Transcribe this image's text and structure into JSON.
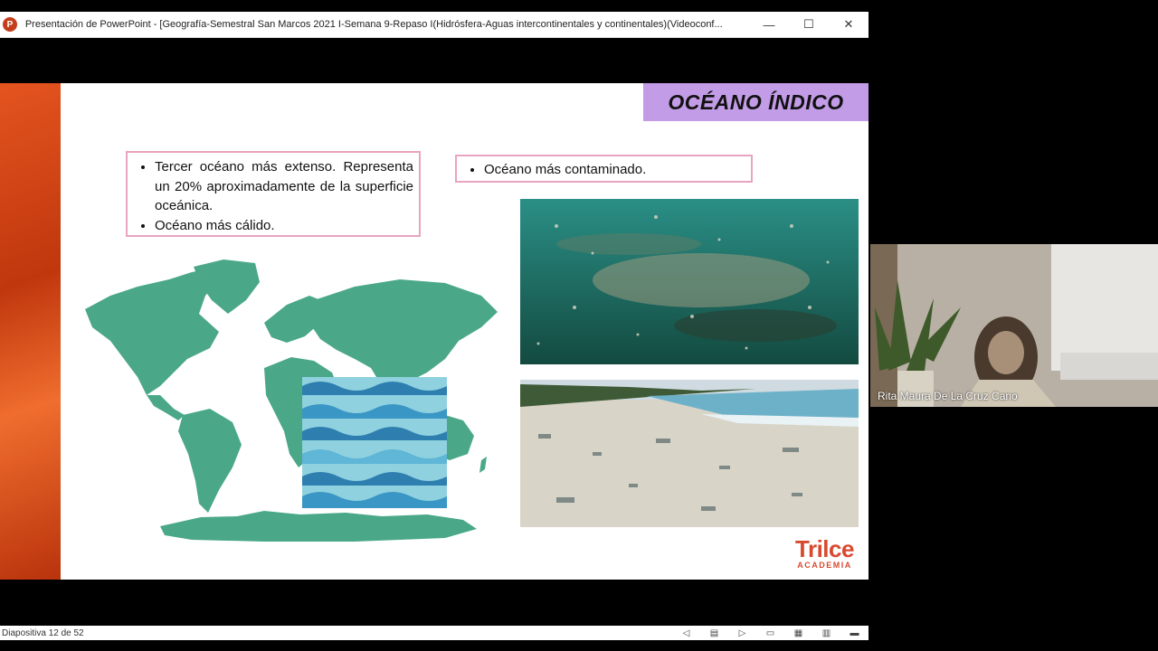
{
  "window": {
    "title": "Presentación de PowerPoint - [Geografía-Semestral San Marcos 2021 I-Semana 9-Repaso I(Hidrósfera-Aguas intercontinentales y continentales)(Videoconf...",
    "app_icon_letter": "P",
    "minimize": "—",
    "maximize": "☐",
    "close": "✕"
  },
  "slide": {
    "title": "OCÉANO ÍNDICO",
    "bullets_left": [
      "Tercer océano más extenso. Representa un 20% aproximadamente de la superficie oceánica.",
      "Océano más cálido."
    ],
    "bullets_right": [
      "Océano más contaminado."
    ],
    "logo": {
      "main": "Trilce",
      "sub": "ACADEMIA"
    }
  },
  "video": {
    "participant_name": "Rita Maura De La Cruz Cano"
  },
  "status": {
    "slide_counter": "Diapositiva 12 de 52"
  },
  "colors": {
    "title_bg": "#c39ce8",
    "bullet_border": "#e8a4c0",
    "map_green": "#4aa888",
    "brand": "#d84a30"
  }
}
